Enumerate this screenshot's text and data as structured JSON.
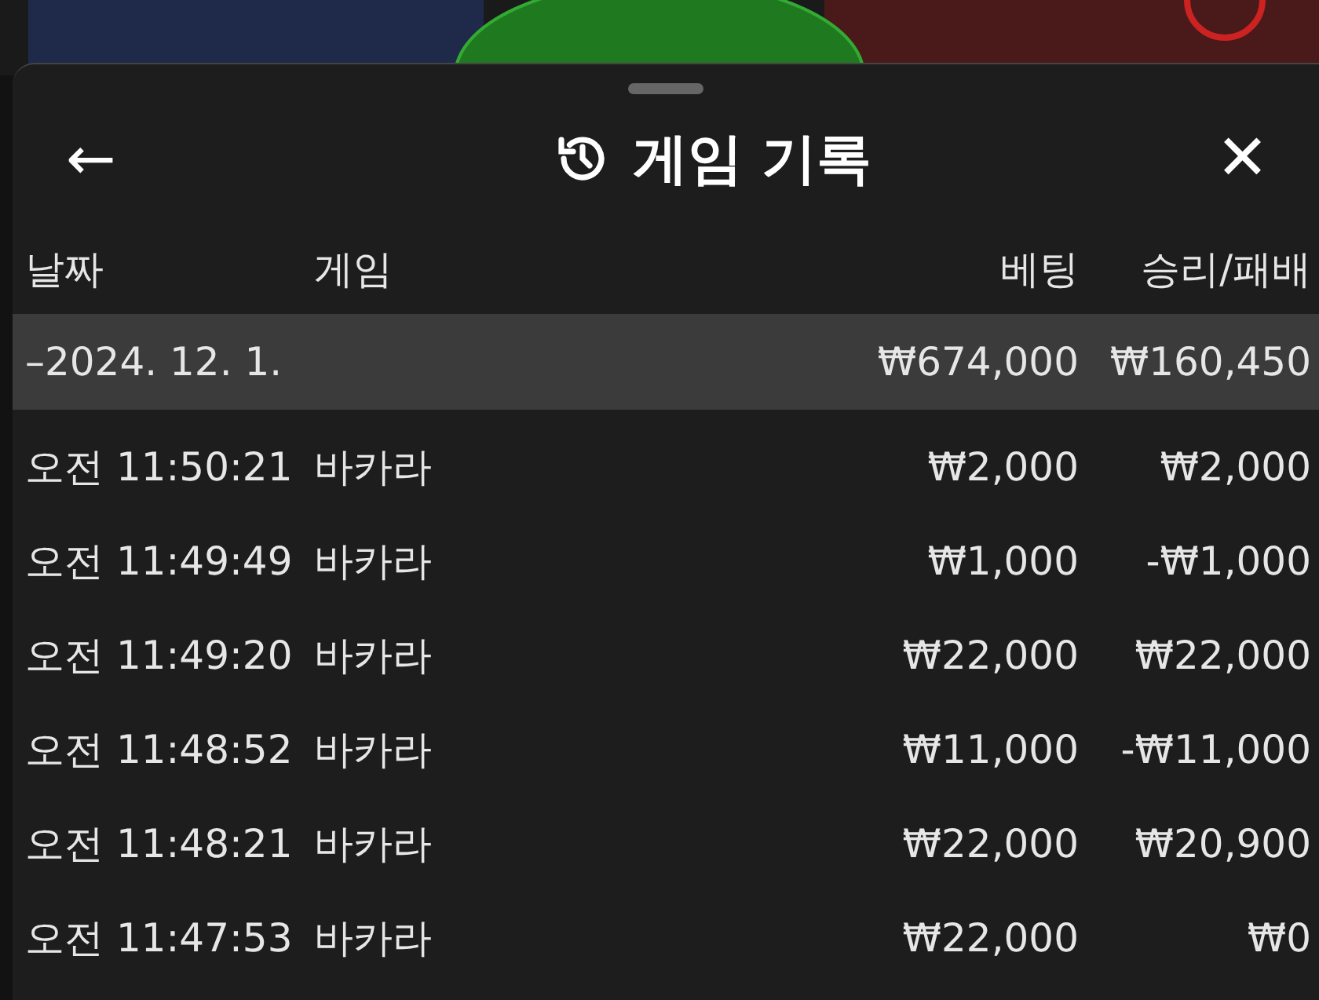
{
  "sheet": {
    "title": "게임 기록",
    "back_icon": "←",
    "close_icon": "✕"
  },
  "table": {
    "columns": [
      "날짜",
      "게임",
      "베팅",
      "승리/패배"
    ],
    "groups": [
      {
        "date": "–2024. 12. 1.",
        "bet": "₩674,000",
        "result": "₩160,450",
        "expanded": true,
        "rows": [
          {
            "time": "오전 11:50:21",
            "game": "바카라",
            "bet": "₩2,000",
            "result": "₩2,000"
          },
          {
            "time": "오전 11:49:49",
            "game": "바카라",
            "bet": "₩1,000",
            "result": "-₩1,000"
          },
          {
            "time": "오전 11:49:20",
            "game": "바카라",
            "bet": "₩22,000",
            "result": "₩22,000"
          },
          {
            "time": "오전 11:48:52",
            "game": "바카라",
            "bet": "₩11,000",
            "result": "-₩11,000"
          },
          {
            "time": "오전 11:48:21",
            "game": "바카라",
            "bet": "₩22,000",
            "result": "₩20,900"
          },
          {
            "time": "오전 11:47:53",
            "game": "바카라",
            "bet": "₩22,000",
            "result": "₩0"
          }
        ]
      }
    ]
  }
}
